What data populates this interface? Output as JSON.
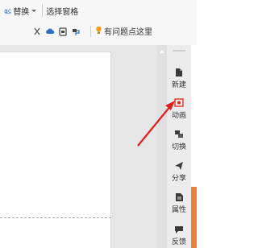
{
  "ribbon": {
    "replace_label": "替换",
    "select_pane_label": "选择窗格",
    "help_text": "有问题点这里"
  },
  "task_pane": {
    "items": [
      {
        "label": "新建",
        "icon": "new-doc-icon"
      },
      {
        "label": "动画",
        "icon": "animation-icon"
      },
      {
        "label": "切换",
        "icon": "switch-icon"
      },
      {
        "label": "分享",
        "icon": "share-icon"
      },
      {
        "label": "属性",
        "icon": "properties-icon"
      },
      {
        "label": "反馈",
        "icon": "feedback-icon"
      }
    ]
  },
  "colors": {
    "accent_orange": "#e8823a",
    "arrow_red": "#e02020",
    "highlight_red": "#d9251c"
  }
}
